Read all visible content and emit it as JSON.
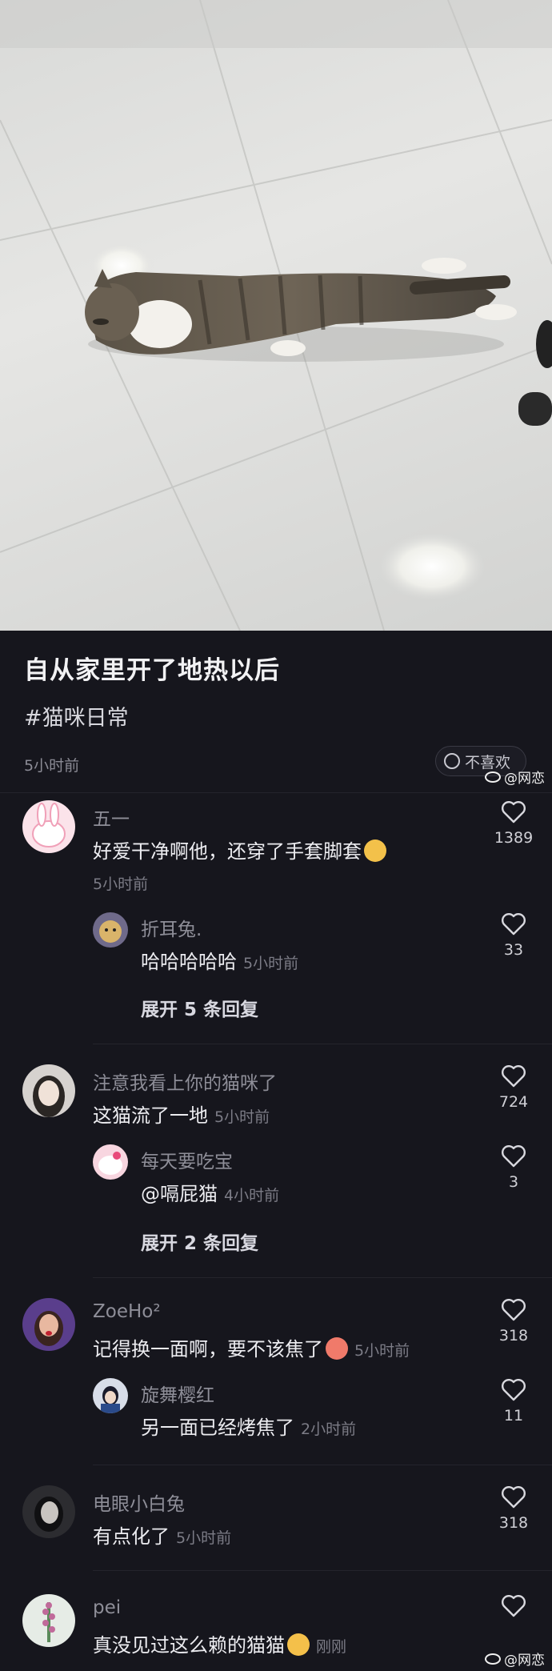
{
  "post": {
    "title": "自从家里开了地热以后",
    "hashtag": "#猫咪日常",
    "time": "5小时前",
    "dislike_label": "不喜欢"
  },
  "watermark": "@网恋",
  "comments": [
    {
      "user": "五一",
      "text": "好爱干净啊他，还穿了手套脚套",
      "time": "5小时前",
      "likes": "1389",
      "reply": {
        "user": "折耳兔.",
        "text": "哈哈哈哈哈",
        "time": "5小时前",
        "likes": "33"
      },
      "expand": "展开 5 条回复"
    },
    {
      "user": "注意我看上你的猫咪了",
      "text": "这猫流了一地",
      "time": "5小时前",
      "likes": "724",
      "reply": {
        "user": "每天要吃宝",
        "text": "@嗝屁猫",
        "time": "4小时前",
        "likes": "3"
      },
      "expand": "展开 2 条回复"
    },
    {
      "user": "ZoeHo²",
      "text": "记得换一面啊，要不该焦了",
      "time": "5小时前",
      "likes": "318",
      "reply": {
        "user": "旋舞樱红",
        "text": "另一面已经烤焦了",
        "time": "2小时前",
        "likes": "11"
      }
    },
    {
      "user": "电眼小白兔",
      "text": "有点化了",
      "time": "5小时前",
      "likes": "318"
    },
    {
      "user": "pei",
      "text": "真没见过这么赖的猫猫",
      "time": "刚刚",
      "likes": ""
    }
  ],
  "colors": {
    "background": "#16161d",
    "text_primary": "#ececf0",
    "text_secondary": "#8e8e98"
  },
  "icons": {
    "like": "heart-outline-icon",
    "dislike": "sad-face-icon"
  }
}
